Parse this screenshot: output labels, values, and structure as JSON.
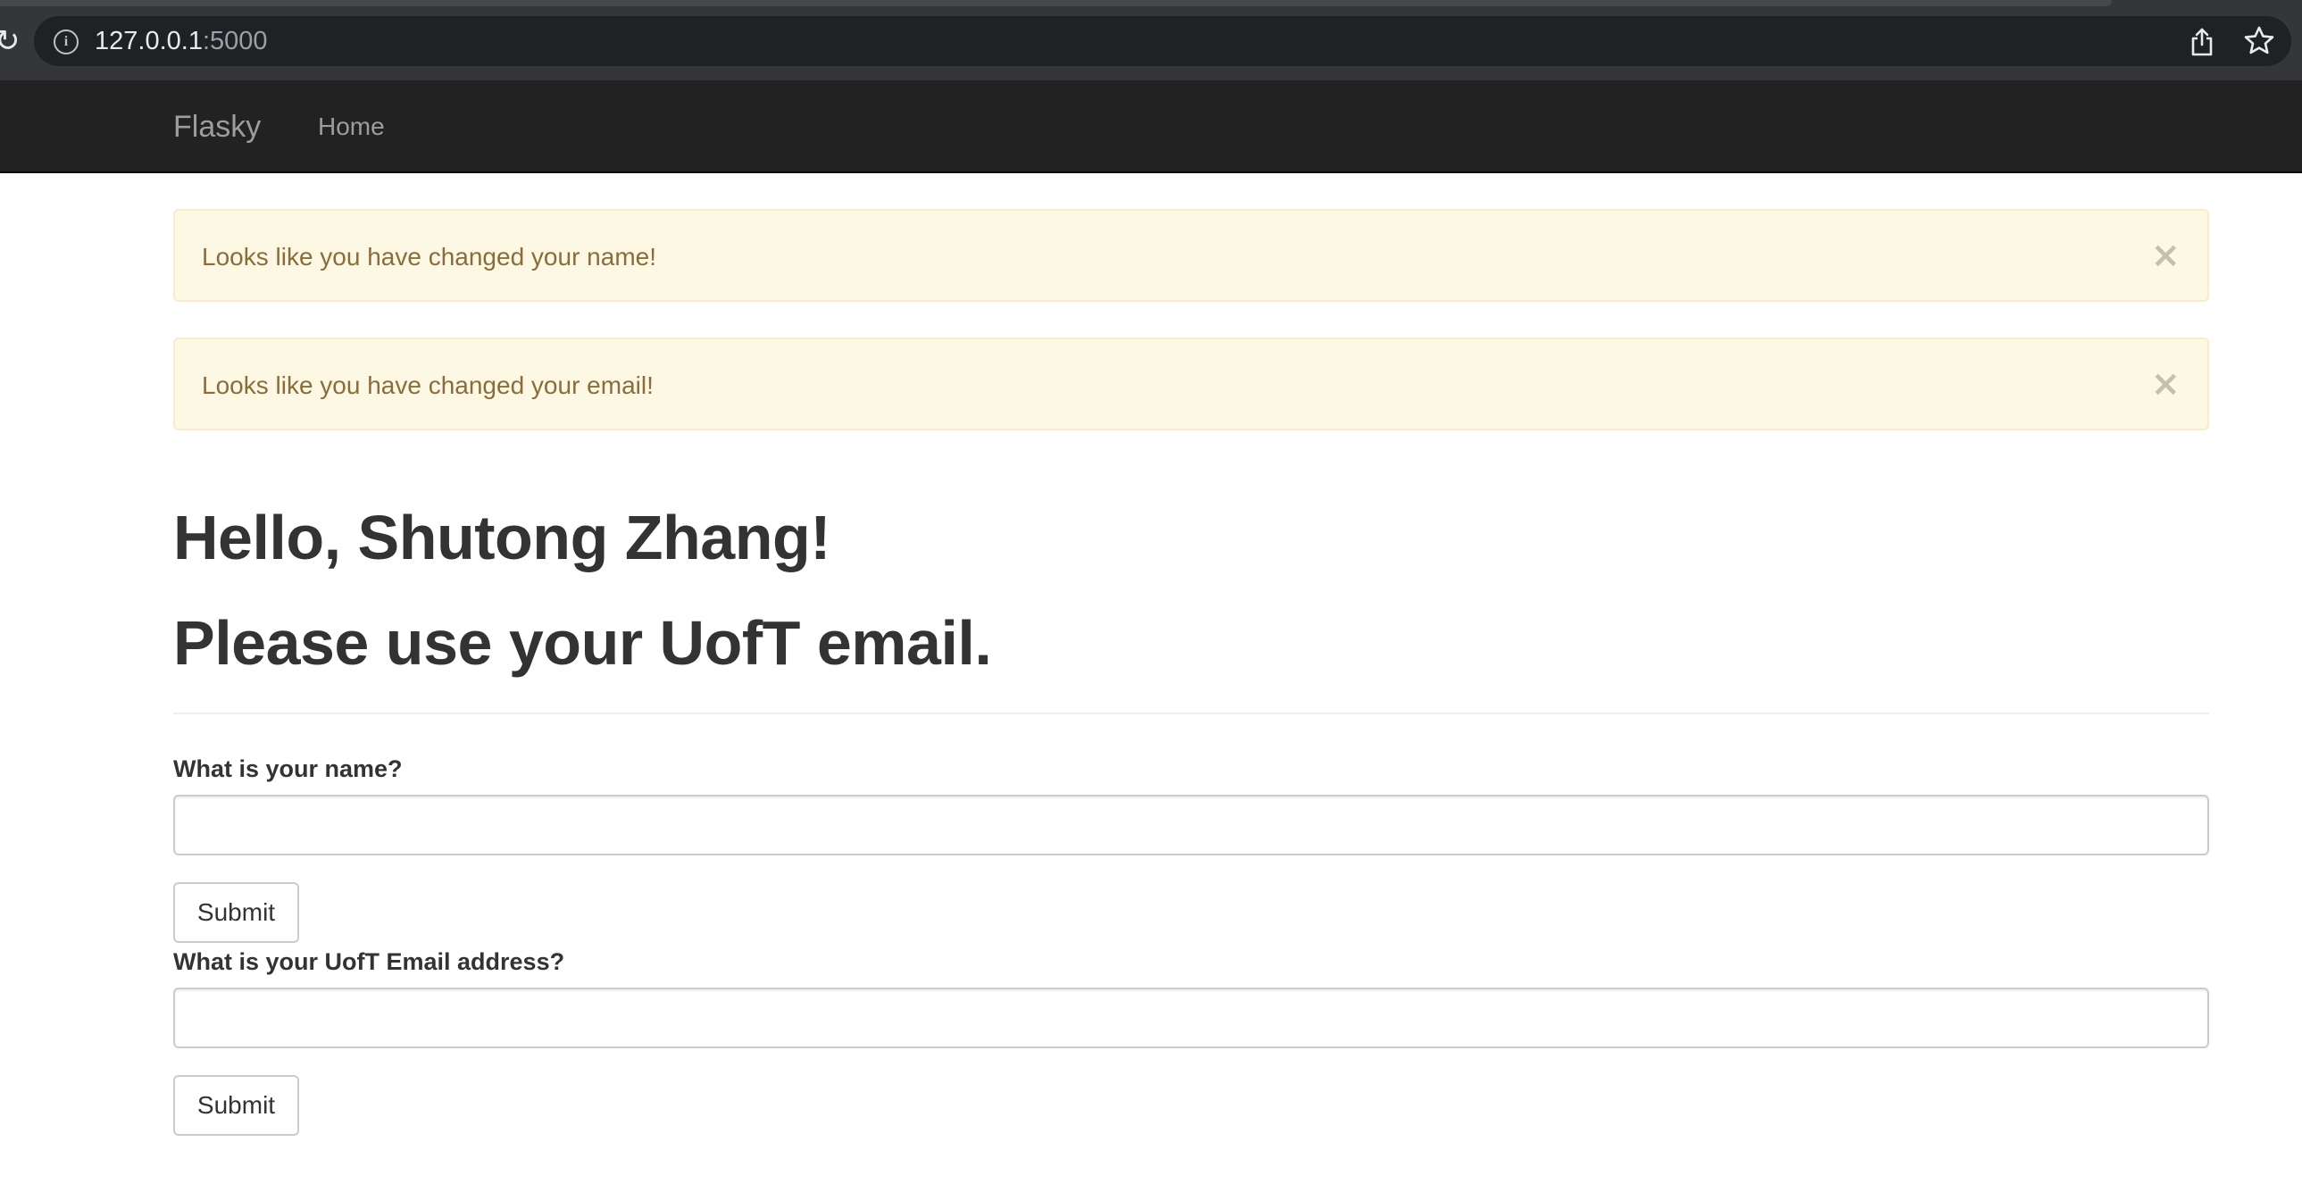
{
  "browser": {
    "url_host": "127.0.0.1",
    "url_port": ":5000"
  },
  "navbar": {
    "brand": "Flasky",
    "home_label": "Home"
  },
  "alerts": [
    {
      "message": "Looks like you have changed your name!",
      "close": "×"
    },
    {
      "message": "Looks like you have changed your email!",
      "close": "×"
    }
  ],
  "page": {
    "greeting": "Hello, Shutong Zhang!",
    "note": "Please use your UofT email."
  },
  "forms": {
    "name": {
      "label": "What is your name?",
      "value": "",
      "submit_label": "Submit"
    },
    "email": {
      "label": "What is your UofT Email address?",
      "value": "",
      "submit_label": "Submit"
    }
  },
  "icons": {
    "reload": "reload-icon",
    "info": "info-icon",
    "share": "share-icon",
    "bookmark": "star-icon",
    "alert_close": "close-icon"
  },
  "colors": {
    "navbar_bg": "#222222",
    "alert_bg": "#fcf8e3",
    "alert_text": "#8a6d3b"
  }
}
